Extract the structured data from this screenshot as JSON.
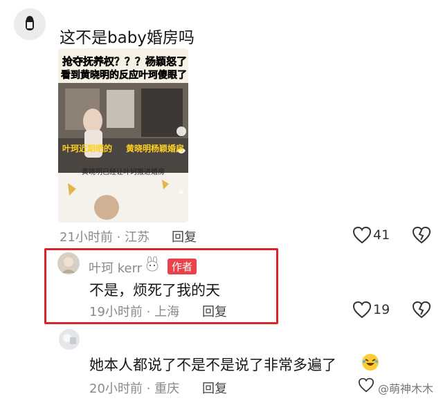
{
  "comment1": {
    "text": "这不是baby婚房吗",
    "video": {
      "headline_line1": "抢夺抚养权？？？杨颖怒了",
      "headline_line2": "看到黄晓明的反应叶珂傻眼了",
      "caption_left": "叶珂近期晒的",
      "caption_right": "黄晓明杨颖婚房",
      "subtitle": "黄晓明已经让叶珂搬进婚房"
    },
    "time_location": "21小时前 · 江苏",
    "reply_label": "回复",
    "likes": "41"
  },
  "comment2": {
    "username": "叶珂 kerr",
    "badge": "作者",
    "text": "不是，烦死了我的天",
    "time_location": "19小时前 · 上海",
    "reply_label": "回复",
    "likes": "19"
  },
  "comment3": {
    "text": "她本人都说了不是不是说了非常多遍了",
    "time_location": "20小时前 · 重庆",
    "reply_label": "回复"
  },
  "watermark": "@萌神木木",
  "colors": {
    "highlight": "#d9222a",
    "badge": "#e8434d"
  }
}
